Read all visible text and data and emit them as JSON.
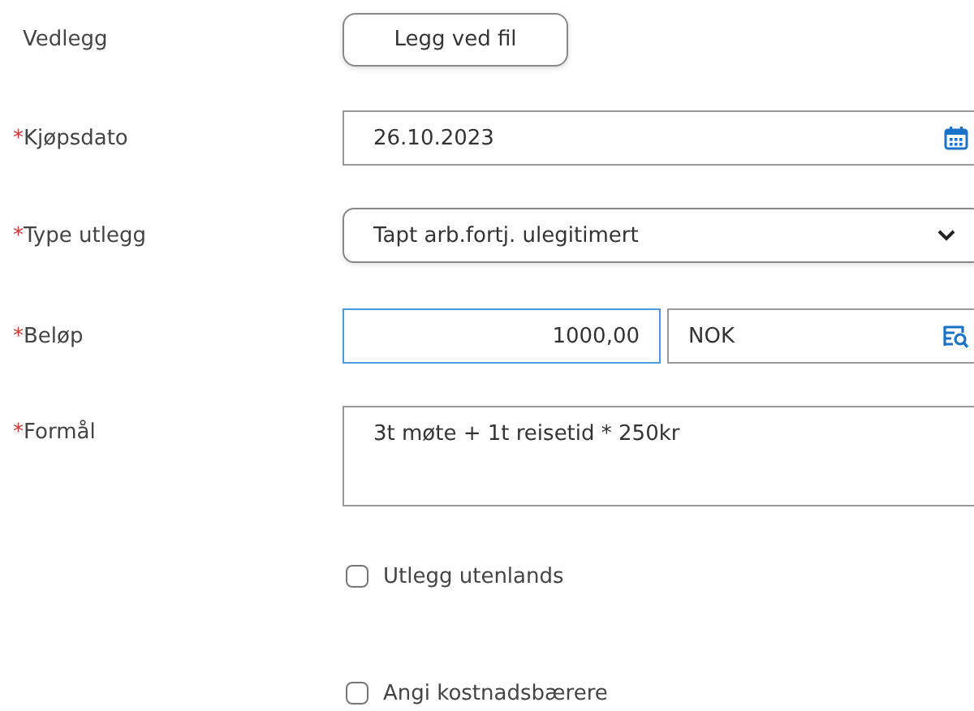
{
  "required_mark": "*",
  "fields": [
    {
      "kind": "file",
      "label": "Vedlegg",
      "required": false,
      "button": "Legg ved fil"
    },
    {
      "kind": "date",
      "label": "Kjøpsdato",
      "required": true,
      "value": "26.10.2023"
    },
    {
      "kind": "select",
      "label": "Type utlegg",
      "required": true,
      "value": "Tapt arb.fortj. ulegitimert"
    },
    {
      "kind": "amount",
      "label": "Beløp",
      "required": true,
      "value": "1000,00",
      "focused": true,
      "currency": "NOK"
    },
    {
      "kind": "textarea",
      "label": "Formål",
      "required": true,
      "value": "3t møte + 1t reisetid * 250kr"
    }
  ],
  "options": [
    {
      "label": "Utlegg utenlands",
      "checked": false
    },
    {
      "label": "Angi kostnadsbærere",
      "checked": false
    }
  ]
}
